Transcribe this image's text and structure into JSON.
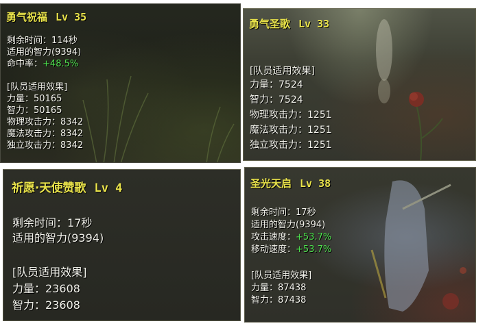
{
  "panels": [
    {
      "title": "勇气祝福",
      "level": "Lv 35",
      "lines": [
        {
          "label": "剩余时间",
          "value": "114秒"
        },
        {
          "text": "适用的智力(9394)"
        },
        {
          "label": "命中率",
          "value": "+48.5%",
          "highlight": true
        },
        {
          "text": "[队员适用效果]"
        },
        {
          "label": "力量",
          "value": "50165"
        },
        {
          "label": "智力",
          "value": "50165"
        },
        {
          "label": "物理攻击力",
          "value": "8342"
        },
        {
          "label": "魔法攻击力",
          "value": "8342"
        },
        {
          "label": "独立攻击力",
          "value": "8342"
        }
      ]
    },
    {
      "title": "勇气圣歌",
      "level": "Lv 33",
      "lines": [
        {
          "text": "[队员适用效果]"
        },
        {
          "label": "力量",
          "value": "7524"
        },
        {
          "label": "智力",
          "value": "7524"
        },
        {
          "label": "物理攻击力",
          "value": "1251"
        },
        {
          "label": "魔法攻击力",
          "value": "1251"
        },
        {
          "label": "独立攻击力",
          "value": "1251"
        }
      ]
    },
    {
      "title": "祈愿·天使赞歌",
      "level": "Lv 4",
      "lines": [
        {
          "label": "剩余时间",
          "value": "17秒"
        },
        {
          "text": "适用的智力(9394)"
        },
        {
          "text": "[队员适用效果]"
        },
        {
          "label": "力量",
          "value": "23608"
        },
        {
          "label": "智力",
          "value": "23608"
        }
      ]
    },
    {
      "title": "圣光天启",
      "level": "Lv 38",
      "lines": [
        {
          "label": "剩余时间",
          "value": "17秒"
        },
        {
          "text": "适用的智力(9394)"
        },
        {
          "label": "攻击速度",
          "value": "+53.7%",
          "highlight": true
        },
        {
          "label": "移动速度",
          "value": "+53.7%",
          "highlight": true
        },
        {
          "text": "[队员适用效果]"
        },
        {
          "label": "力量",
          "value": "87438"
        },
        {
          "label": "智力",
          "value": "87438"
        }
      ]
    }
  ],
  "separator": "：",
  "colors": {
    "title": "#e8e24a",
    "text": "#f1f1ea",
    "highlight": "#4ee04e"
  },
  "decor_icons": [
    "grass-icon",
    "flower-icon",
    "character-silhouette-icon"
  ]
}
